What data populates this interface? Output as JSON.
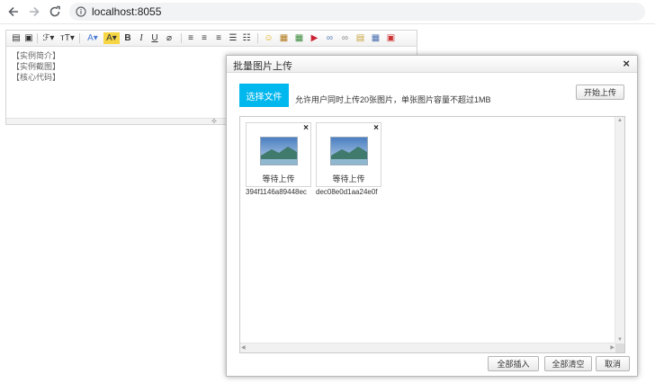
{
  "browser": {
    "url": "localhost:8055",
    "icons": [
      "back-arrow-icon",
      "forward-arrow-icon",
      "reload-icon",
      "info-icon"
    ]
  },
  "editor": {
    "lines": [
      "【实例简介】",
      "【实例截图】",
      "【核心代码】"
    ],
    "toolbar_icons": [
      "source-icon",
      "template-icon",
      "font-family-icon",
      "font-size-icon",
      "font-color-icon",
      "highlight-icon",
      "bold-icon",
      "italic-icon",
      "underline-icon",
      "clear-format-icon",
      "align-left-icon",
      "align-center-icon",
      "align-right-icon",
      "ordered-list-icon",
      "unordered-list-icon",
      "emoji-icon",
      "image-icon",
      "multi-image-icon",
      "flash-icon",
      "link-icon",
      "unlink-icon",
      "attachment-icon",
      "table-icon",
      "fullscreen-icon"
    ]
  },
  "dialog": {
    "title": "批量图片上传",
    "close": "×",
    "select_label": "选择文件",
    "hint": "允许用户同时上传20张图片，单张图片容量不超过1MB",
    "start_label": "开始上传",
    "files": [
      {
        "status": "等待上传",
        "name": "394f1146a89448ec"
      },
      {
        "status": "等待上传",
        "name": "dec08e0d1aa24e0f"
      }
    ],
    "delete_label": "×",
    "buttons": {
      "insert_all": "全部插入",
      "clear_all": "全部清空",
      "cancel": "取消"
    }
  }
}
